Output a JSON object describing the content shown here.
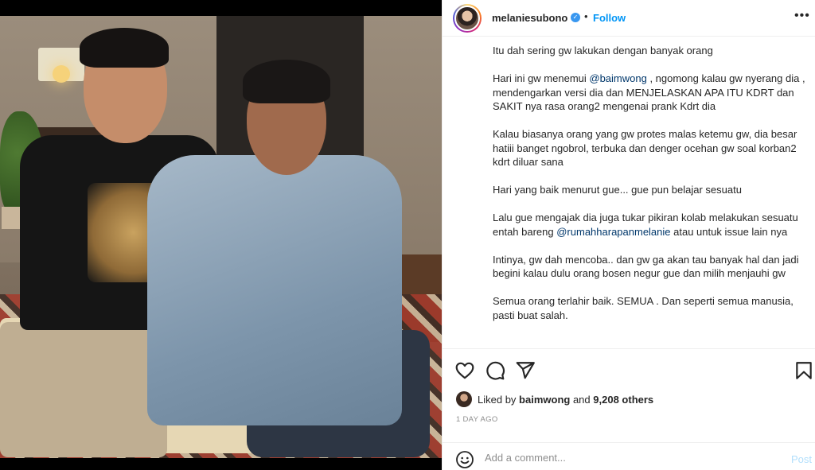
{
  "post": {
    "username": "melaniesubono",
    "verified_mark": "✓",
    "dot": "•",
    "follow_label": "Follow",
    "more_label": "•••"
  },
  "caption": {
    "p1": "Itu dah sering gw lakukan dengan banyak orang",
    "p2_a": "Hari ini gw menemui ",
    "p2_mention": "@baimwong",
    "p2_b": " , ngomong kalau gw nyerang dia , mendengarkan versi dia dan MENJELASKAN APA ITU KDRT dan SAKIT nya rasa orang2 mengenai prank Kdrt dia",
    "p3": "Kalau biasanya orang yang gw protes malas ketemu gw, dia besar hatiii banget ngobrol, terbuka dan denger ocehan gw soal korban2 kdrt diluar sana",
    "p4": "Hari yang baik menurut gue... gue pun belajar sesuatu",
    "p5_a": "Lalu gue mengajak dia juga tukar pikiran kolab melakukan sesuatu entah bareng ",
    "p5_mention": "@rumahharapanmelanie",
    "p5_b": " atau untuk issue lain nya",
    "p6": "Intinya, gw dah mencoba.. dan gw ga akan tau banyak hal dan jadi begini kalau dulu orang bosen negur gue dan milih menjauhi gw",
    "p7": "Semua orang terlahir baik. SEMUA . Dan seperti semua manusia, pasti buat salah."
  },
  "likes": {
    "prefix": "Liked by ",
    "user": "baimwong",
    "middle": " and ",
    "others": "9,208 others"
  },
  "timestamp": "1 DAY AGO",
  "comment": {
    "placeholder": "Add a comment...",
    "post_label": "Post"
  },
  "icons": {
    "like": "heart-icon",
    "comment": "comment-icon",
    "share": "share-icon",
    "save": "bookmark-icon",
    "emoji": "emoji-icon"
  },
  "colors": {
    "accent": "#0095f6",
    "verified": "#3897f0",
    "mention": "#00376b",
    "muted": "#8e8e8e",
    "post_disabled": "#b2dffc"
  }
}
